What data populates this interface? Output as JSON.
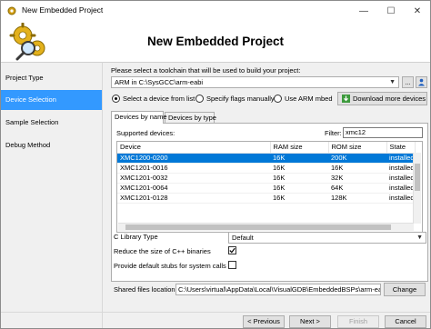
{
  "window": {
    "title": "New Embedded Project",
    "min_glyph": "—",
    "max_glyph": "☐",
    "close_glyph": "✕"
  },
  "header": {
    "title": "New Embedded Project"
  },
  "sidebar": {
    "items": [
      {
        "label": "Project Type",
        "selected": false
      },
      {
        "label": "Device Selection",
        "selected": true
      },
      {
        "label": "Sample Selection",
        "selected": false
      },
      {
        "label": "Debug Method",
        "selected": false
      }
    ]
  },
  "toolchain": {
    "prompt": "Please select a toolchain that will be used to build your project:",
    "value": "ARM in C:\\SysGCC\\arm-eabi",
    "more_label": "..."
  },
  "mode": {
    "options": [
      {
        "label": "Select a device from list",
        "checked": true
      },
      {
        "label": "Specify flags manually",
        "checked": false
      },
      {
        "label": "Use ARM mbed",
        "checked": false
      }
    ],
    "download_label": "Download more devices"
  },
  "tabs": [
    {
      "label": "Devices by name",
      "active": true
    },
    {
      "label": "Devices by type",
      "active": false
    }
  ],
  "devices": {
    "supported_label": "Supported devices:",
    "filter_label": "Filter:",
    "filter_value": "xmc12",
    "columns": [
      "Device",
      "RAM size",
      "ROM size",
      "State"
    ],
    "rows": [
      [
        "XMC1200-0200",
        "16K",
        "200K",
        "installed"
      ],
      [
        "XMC1201-0016",
        "16K",
        "16K",
        "installed"
      ],
      [
        "XMC1201-0032",
        "16K",
        "32K",
        "installed"
      ],
      [
        "XMC1201-0064",
        "16K",
        "64K",
        "installed"
      ],
      [
        "XMC1201-0128",
        "16K",
        "128K",
        "installed"
      ]
    ],
    "selected_index": 0
  },
  "options": {
    "clib_label": "C Library Type",
    "clib_value": "Default",
    "reduce_label": "Reduce the size of C++ binaries",
    "reduce_checked": true,
    "stubs_label": "Provide default stubs for system calls",
    "stubs_checked": false
  },
  "shared": {
    "label": "Shared files location:",
    "value": "C:\\Users\\virtual\\AppData\\Local\\VisualGDB\\EmbeddedBSPs\\arm-eabi\\c",
    "change_label": "Change"
  },
  "footer": {
    "previous_label": "< Previous",
    "next_label": "Next >",
    "finish_label": "Finish",
    "cancel_label": "Cancel"
  },
  "colors": {
    "selection": "#0078d7",
    "sidebar_selected": "#3399ff",
    "panel_bg": "#f0f0f0"
  }
}
